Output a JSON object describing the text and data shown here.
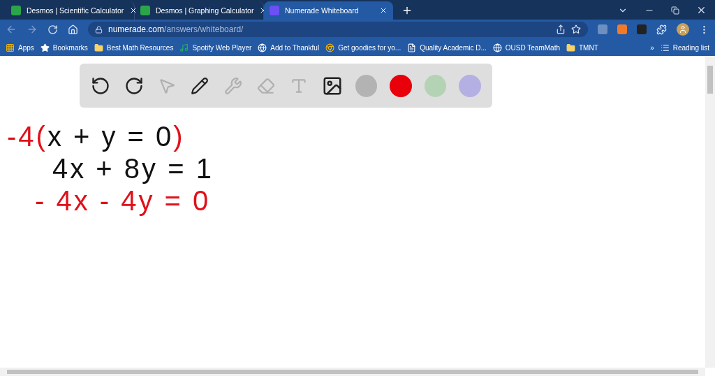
{
  "tabs": [
    {
      "title": "Desmos | Scientific Calculator",
      "kind": "desmos",
      "selected": false
    },
    {
      "title": "Desmos | Graphing Calculator",
      "kind": "desmos",
      "selected": false
    },
    {
      "title": "Numerade Whiteboard",
      "kind": "numerade",
      "selected": true
    }
  ],
  "address": {
    "host": "numerade.com",
    "path": "/answers/whiteboard/"
  },
  "bookmarks": [
    {
      "label": "Apps",
      "kind": "apps"
    },
    {
      "label": "Bookmarks",
      "kind": "star"
    },
    {
      "label": "Best Math Resources",
      "kind": "folder"
    },
    {
      "label": "Spotify Web Player",
      "kind": "spotify"
    },
    {
      "label": "Add to Thankful",
      "kind": "globe"
    },
    {
      "label": "Get goodies for yo...",
      "kind": "chrome"
    },
    {
      "label": "Quality Academic D...",
      "kind": "doc"
    },
    {
      "label": "OUSD TeamMath",
      "kind": "globe"
    },
    {
      "label": "TMNT",
      "kind": "folder"
    }
  ],
  "more_bookmarks": "»",
  "reading_list": "Reading list",
  "tools": [
    {
      "kind": "undo",
      "disabled": false
    },
    {
      "kind": "redo",
      "disabled": false
    },
    {
      "kind": "select",
      "disabled": true
    },
    {
      "kind": "pen",
      "disabled": false
    },
    {
      "kind": "tools",
      "disabled": true
    },
    {
      "kind": "eraser",
      "disabled": true
    },
    {
      "kind": "text",
      "disabled": true
    },
    {
      "kind": "image",
      "disabled": false
    }
  ],
  "swatches": [
    {
      "color": "#b3b3b3"
    },
    {
      "color": "#e8000b"
    },
    {
      "color": "#b4d3b4"
    },
    {
      "color": "#b5b0e3"
    }
  ],
  "ink_lines": [
    [
      {
        "text": "-4",
        "color": "#e0101a"
      },
      {
        "text": "(",
        "color": "#e0101a"
      },
      {
        "text": "x + y = 0",
        "color": "#111111"
      },
      {
        "text": ")",
        "color": "#e0101a"
      }
    ],
    [
      {
        "text": "4x + 8y = 1",
        "color": "#111111"
      }
    ],
    [
      {
        "text": "- 4x  - 4y = 0",
        "color": "#e0101a"
      }
    ]
  ]
}
